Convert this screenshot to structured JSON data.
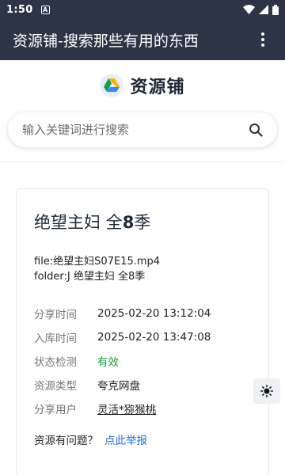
{
  "status": {
    "time": "1:50",
    "a_icon": "A"
  },
  "appbar": {
    "title": "资源铺-搜索那些有用的东西"
  },
  "brand": {
    "name": "资源铺"
  },
  "search": {
    "placeholder": "输入关键词进行搜索"
  },
  "resource": {
    "title_prefix": "绝望主妇 全",
    "title_num": "8",
    "title_suffix": "季",
    "file_line": "file:绝望主妇S07E15.mp4",
    "folder_line": "folder:J 绝望主妇 全8季",
    "fields": {
      "share_time_label": "分享时间",
      "share_time": "2025-02-20 13:12:04",
      "index_time_label": "入库时间",
      "index_time": "2025-02-20 13:47:08",
      "status_label": "状态检测",
      "status": "有效",
      "type_label": "资源类型",
      "type": "夸克网盘",
      "user_label": "分享用户",
      "user": "灵活*猕猴桃"
    },
    "report_question": "资源有问题？",
    "report_link": "点此举报"
  },
  "colors": {
    "header": "#2d3446",
    "link": "#1e6fe0",
    "ok": "#1a9e3a"
  },
  "icons": [
    "wifi-icon",
    "signal-icon",
    "battery-icon",
    "overflow-menu-icon",
    "logo-icon",
    "search-icon",
    "sun-icon"
  ]
}
